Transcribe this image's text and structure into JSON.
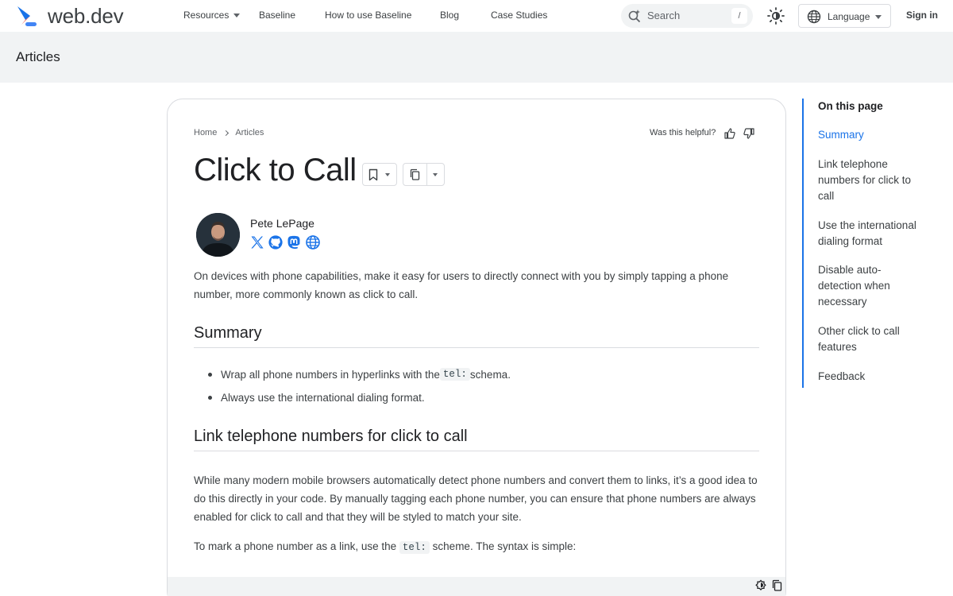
{
  "header": {
    "logo_text": "web.dev",
    "nav": [
      {
        "label": "Resources",
        "has_dropdown": true
      },
      {
        "label": "Baseline"
      },
      {
        "label": "How to use Baseline"
      },
      {
        "label": "Blog"
      },
      {
        "label": "Case Studies"
      }
    ],
    "search_placeholder": "Search",
    "search_shortcut": "/",
    "language_label": "Language",
    "signin_label": "Sign in"
  },
  "band": {
    "title": "Articles"
  },
  "article": {
    "breadcrumb": [
      "Home",
      "Articles"
    ],
    "helpful_label": "Was this helpful?",
    "title": "Click to Call",
    "author": {
      "name": "Pete LePage",
      "socials": [
        "x-icon",
        "github-icon",
        "mastodon-icon",
        "website-icon"
      ]
    },
    "intro_1": "On devices with phone capabilities, make it easy for users to directly connect with you by simply tapping a phone",
    "intro_2": "number, more commonly known as click to call.",
    "summary_heading": "Summary",
    "bullets": [
      {
        "before": "Wrap all phone numbers in hyperlinks with the ",
        "code": "tel:",
        "after": " schema."
      },
      {
        "before": "Always use the international dialing format.",
        "code": "",
        "after": ""
      }
    ],
    "section2_heading": "Link telephone numbers for click to call",
    "body_1": "While many modern mobile browsers automatically detect phone numbers and convert them to links, it’s a good idea to",
    "body_2": "do this directly in your code. By manually tagging each phone number, you can ensure that phone numbers are always",
    "body_3": "enabled for click to call and that they will be styled to match your site.",
    "body_4_before": "To mark a phone number as a link, use the ",
    "body_4_code": "tel:",
    "body_4_after": " scheme. The syntax is simple:"
  },
  "toc": {
    "title": "On this page",
    "items": [
      {
        "label": "Summary",
        "active": true
      },
      {
        "label": "Link telephone numbers for click to call"
      },
      {
        "label": "Use the international dialing format"
      },
      {
        "label": "Disable auto-detection when necessary"
      },
      {
        "label": "Other click to call features"
      },
      {
        "label": "Feedback"
      }
    ]
  },
  "colors": {
    "accent": "#1a73e8",
    "band": "#f1f3f4",
    "text": "#202124"
  }
}
